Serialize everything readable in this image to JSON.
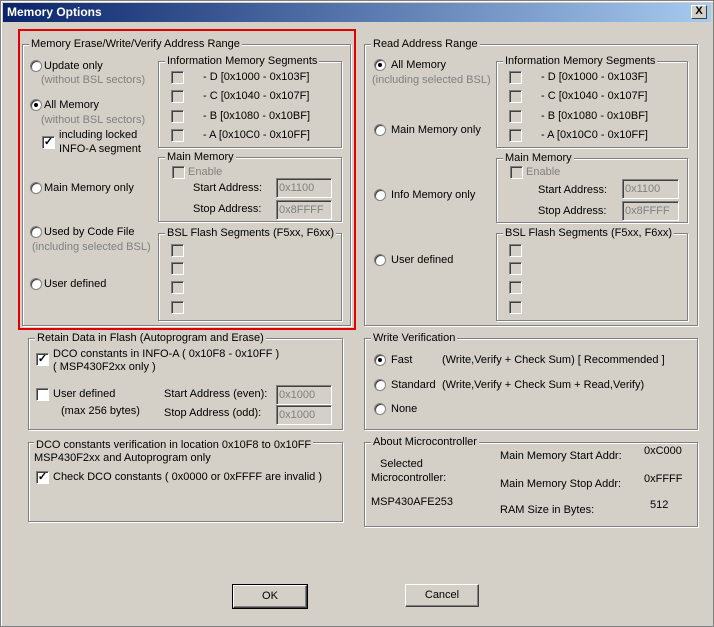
{
  "window": {
    "title": "Memory Options",
    "close": "X"
  },
  "erase": {
    "title": "Memory Erase/Write/Verify Address Range",
    "options": [
      {
        "label": "Update only",
        "sub": "(without BSL sectors)"
      },
      {
        "label": "All Memory",
        "sub": "(without BSL sectors)"
      },
      {
        "label": "Main Memory only"
      },
      {
        "label": "Used by Code File",
        "sub": "(including selected BSL)"
      },
      {
        "label": "User defined"
      }
    ],
    "locked_label_1": "including locked",
    "locked_label_2": "INFO-A segment",
    "info_title": "Information Memory Segments",
    "segments": [
      "- D  [0x1000 - 0x103F]",
      "- C  [0x1040 - 0x107F]",
      "- B  [0x1080 - 0x10BF]",
      "- A  [0x10C0 - 0x10FF]"
    ],
    "main_title": "Main Memory",
    "enable": "Enable",
    "start_label": "Start Address:",
    "start_value": "0x1100",
    "stop_label": "Stop Address:",
    "stop_value": "0x8FFFF",
    "bsl_title": "BSL Flash Segments (F5xx, F6xx)"
  },
  "read": {
    "title": "Read Address Range",
    "options": [
      {
        "label": "All Memory",
        "sub": "(including selected BSL)"
      },
      {
        "label": "Main Memory only"
      },
      {
        "label": "Info Memory only"
      },
      {
        "label": "User defined"
      }
    ],
    "info_title": "Information Memory Segments",
    "segments": [
      "- D  [0x1000 - 0x103F]",
      "- C  [0x1040 - 0x107F]",
      "- B  [0x1080 - 0x10BF]",
      "- A  [0x10C0 - 0x10FF]"
    ],
    "main_title": "Main Memory",
    "enable": "Enable",
    "start_label": "Start Address:",
    "start_value": "0x1100",
    "stop_label": "Stop Address:",
    "stop_value": "0x8FFFF",
    "bsl_title": "BSL Flash Segments (F5xx, F6xx)"
  },
  "retain": {
    "title": "Retain Data in Flash   (Autoprogram and Erase)",
    "dco_1": "DCO constants in INFO-A ( 0x10F8 - 0x10FF )",
    "dco_2": "( MSP430F2xx only )",
    "user_defined": "User defined",
    "max_bytes": "(max 256 bytes)",
    "start_label": "Start Address (even):",
    "start_value": "0x1000",
    "stop_label": "Stop Address (odd):",
    "stop_value": "0x1000"
  },
  "dco_verify": {
    "line1": "DCO constants verification in location 0x10F8 to 0x10FF",
    "line2": "MSP430F2xx and Autoprogram only",
    "check": "Check DCO constants ( 0x0000 or 0xFFFF are invalid )"
  },
  "write_verify": {
    "title": "Write Verification",
    "options": [
      {
        "label": "Fast",
        "desc": "(Write,Verify + Check Sum)  [ Recommended ]"
      },
      {
        "label": "Standard",
        "desc": "(Write,Verify + Check Sum + Read,Verify)"
      },
      {
        "label": "None",
        "desc": ""
      }
    ]
  },
  "about": {
    "title": "About Microcontroller",
    "selected_1": "Selected",
    "selected_2": "Microcontroller:",
    "device": "MSP430AFE253",
    "main_start_label": "Main Memory Start Addr:",
    "main_start_value": "0xC000",
    "main_stop_label": "Main Memory Stop Addr:",
    "main_stop_value": "0xFFFF",
    "ram_label": "RAM Size in Bytes:",
    "ram_value": "512"
  },
  "buttons": {
    "ok": "OK",
    "cancel": "Cancel"
  }
}
